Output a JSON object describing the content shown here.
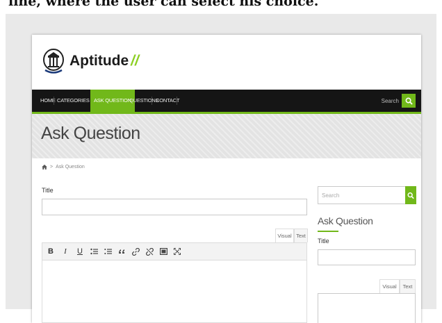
{
  "caption": "line, where the user can select his choice.",
  "site": {
    "logo_text": "Aptitude",
    "logo_slashes": "//"
  },
  "nav": {
    "items": [
      {
        "label": "HOME"
      },
      {
        "label": "CATEGORIES"
      },
      {
        "label": "ASK QUESTION"
      },
      {
        "label": "QUESTIONS"
      },
      {
        "label": "CONTACT"
      }
    ],
    "search_placeholder": "Search"
  },
  "banner": {
    "title": "Ask Question"
  },
  "breadcrumb": {
    "separator": ">",
    "current": "Ask Question"
  },
  "main": {
    "title_label": "Title",
    "title_value": "",
    "tab_visual": "Visual",
    "tab_text": "Text",
    "toolbar": {
      "bold": "B",
      "italic": "I",
      "underline": "U",
      "icons": [
        "bullet-list-icon",
        "numbered-list-icon",
        "blockquote-icon",
        "link-icon",
        "unlink-icon",
        "image-icon",
        "fullscreen-icon"
      ]
    },
    "body_value": ""
  },
  "sidebar": {
    "search_placeholder": "Search",
    "heading": "Ask Question",
    "title_label": "Title",
    "tab_visual": "Visual",
    "tab_text": "Text"
  },
  "colors": {
    "accent": "#71b81a",
    "nav_bg": "#151515",
    "banner_bg": "#e3e3e3"
  }
}
